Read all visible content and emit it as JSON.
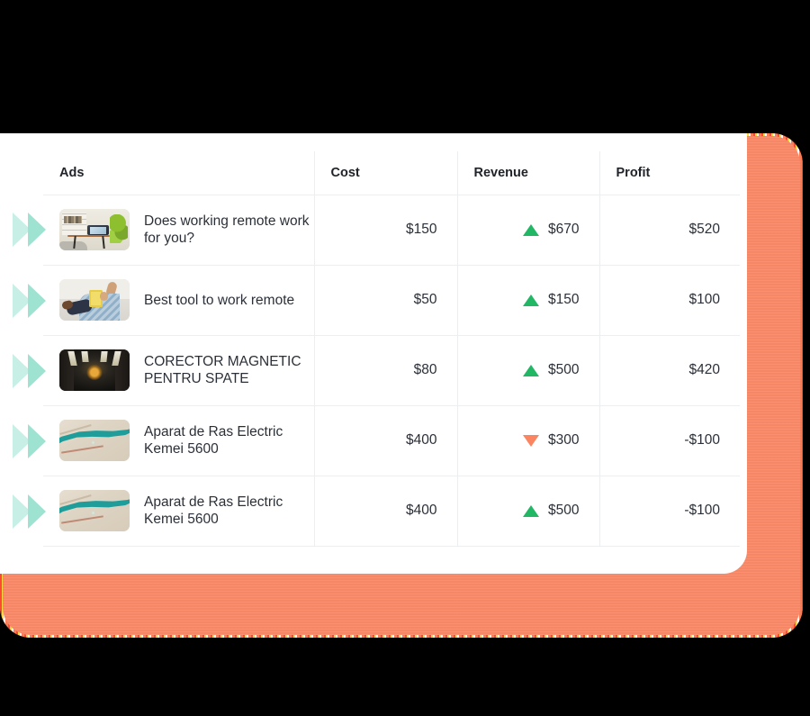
{
  "theme": {
    "card_background": "#ffffff",
    "backdrop_accent": "#fb8a68",
    "chevron_light": "#c7efe6",
    "chevron_dark": "#9ee2d1",
    "trend_up_color": "#21b765",
    "trend_down_color": "#fa8560",
    "text_color": "#2b3038",
    "divider_color": "#eceef0"
  },
  "table": {
    "columns": [
      {
        "key": "ads",
        "label": "Ads",
        "align": "left"
      },
      {
        "key": "cost",
        "label": "Cost",
        "align": "right"
      },
      {
        "key": "revenue",
        "label": "Revenue",
        "align": "right"
      },
      {
        "key": "profit",
        "label": "Profit",
        "align": "right"
      }
    ],
    "rows": [
      {
        "marker_icon": "double-chevron-right-icon",
        "thumbnail_icon": "ad-thumbnail-home-office",
        "title": "Does working remote work for you?",
        "cost": "$150",
        "revenue": "$670",
        "revenue_trend": "up",
        "revenue_trend_icon": "triangle-up-icon",
        "profit": "$520"
      },
      {
        "marker_icon": "double-chevron-right-icon",
        "thumbnail_icon": "ad-thumbnail-person-reading",
        "title": "Best tool to work remote",
        "cost": "$50",
        "revenue": "$150",
        "revenue_trend": "up",
        "revenue_trend_icon": "triangle-up-icon",
        "profit": "$100"
      },
      {
        "marker_icon": "double-chevron-right-icon",
        "thumbnail_icon": "ad-thumbnail-dark-corridor",
        "title": "CORECTOR MAGNETIC PENTRU SPATE",
        "cost": "$80",
        "revenue": "$500",
        "revenue_trend": "up",
        "revenue_trend_icon": "triangle-up-icon",
        "profit": "$420"
      },
      {
        "marker_icon": "double-chevron-right-icon",
        "thumbnail_icon": "ad-thumbnail-teal-river",
        "title": "Aparat de Ras Electric Kemei 5600",
        "cost": "$400",
        "revenue": "$300",
        "revenue_trend": "down",
        "revenue_trend_icon": "triangle-down-icon",
        "profit": "-$100"
      },
      {
        "marker_icon": "double-chevron-right-icon",
        "thumbnail_icon": "ad-thumbnail-teal-river",
        "title": "Aparat de Ras Electric Kemei 5600",
        "cost": "$400",
        "revenue": "$500",
        "revenue_trend": "up",
        "revenue_trend_icon": "triangle-up-icon",
        "profit": "-$100"
      }
    ]
  }
}
